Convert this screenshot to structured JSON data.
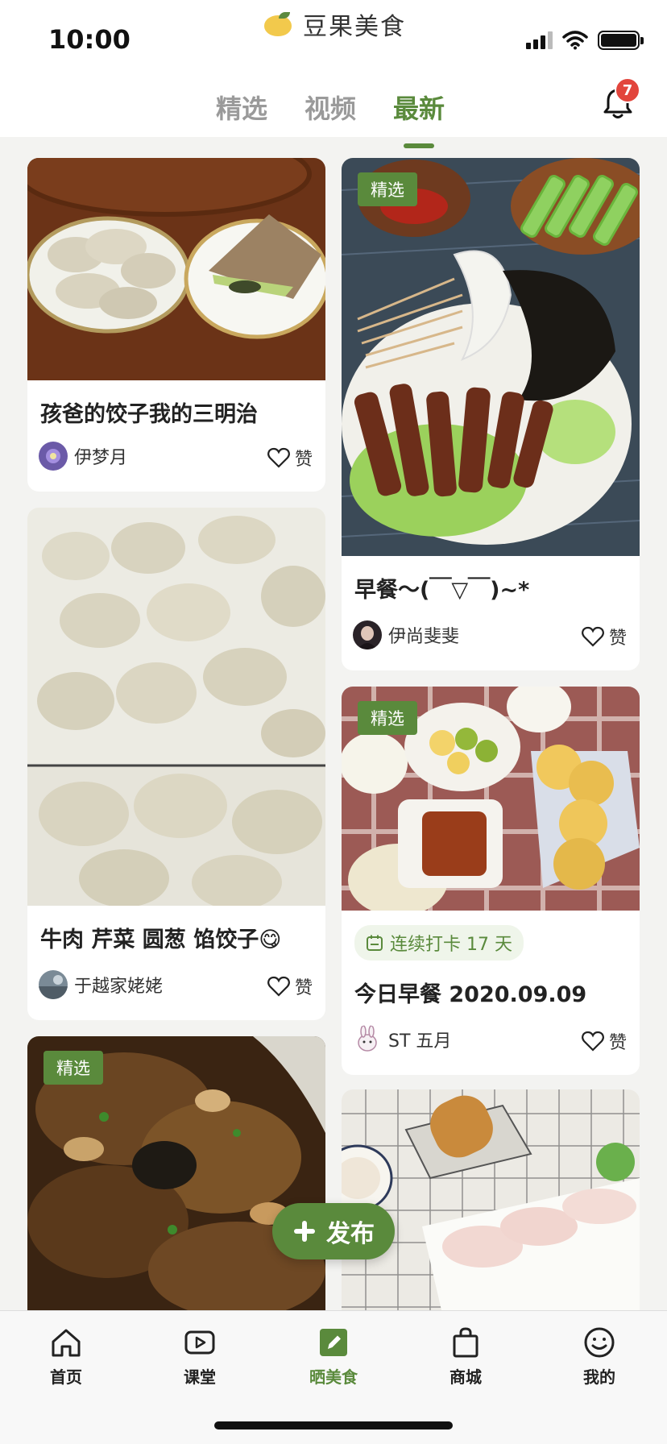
{
  "status_bar": {
    "time": "10:00"
  },
  "app": {
    "name": "豆果美食"
  },
  "topnav": {
    "tabs": [
      {
        "label": "精选",
        "active": false
      },
      {
        "label": "视频",
        "active": false
      },
      {
        "label": "最新",
        "active": true
      }
    ],
    "notification_count": "7"
  },
  "feed": {
    "left": [
      {
        "title": "孩爸的饺子我的三明治",
        "author": "伊梦月",
        "like_label": "赞",
        "tag": ""
      },
      {
        "title": "牛肉  芹菜  圆葱  馅饺子😋",
        "author": "于越家姥姥",
        "like_label": "赞",
        "tag": ""
      },
      {
        "title": "",
        "author": "",
        "like_label": "",
        "tag": "精选"
      }
    ],
    "right": [
      {
        "title": "早餐～(￣▽￣)~*",
        "author": "伊尚斐斐",
        "like_label": "赞",
        "tag": "精选"
      },
      {
        "title": "今日早餐 2020.09.09",
        "author": "ST 五月",
        "like_label": "赞",
        "tag": "精选",
        "streak": "连续打卡 17 天"
      },
      {
        "title": "",
        "author": "",
        "like_label": "",
        "tag": ""
      }
    ]
  },
  "fab": {
    "label": "发布"
  },
  "tabbar": {
    "items": [
      {
        "label": "首页",
        "icon": "home-icon"
      },
      {
        "label": "课堂",
        "icon": "play-icon"
      },
      {
        "label": "晒美食",
        "icon": "edit-icon",
        "active": true
      },
      {
        "label": "商城",
        "icon": "bag-icon"
      },
      {
        "label": "我的",
        "icon": "smiley-icon"
      }
    ]
  },
  "colors": {
    "accent": "#5a8a3c",
    "badge": "#e2453c"
  }
}
